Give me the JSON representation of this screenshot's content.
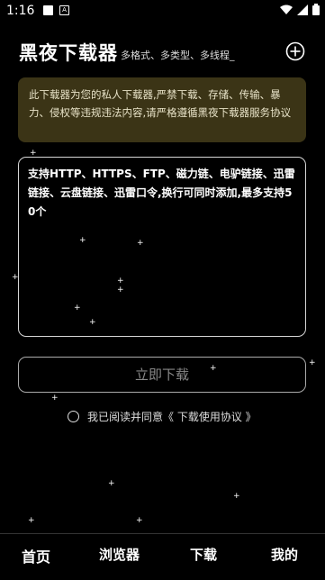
{
  "status_bar": {
    "time": "1:16"
  },
  "header": {
    "title": "黑夜下载器",
    "subtitle": "多格式、多类型、多线程_"
  },
  "notice": {
    "text": "此下载器为您的私人下载器,严禁下载、存储、传输、暴力、侵权等违规违法内容,请严格遵循黑夜下载器服务协议"
  },
  "url_input": {
    "placeholder": "支持HTTP、HTTPS、FTP、磁力链、电驴链接、迅雷链接、云盘链接、迅雷口令,换行可同时添加,最多支持50个"
  },
  "download_button": {
    "label": "立即下载"
  },
  "agreement": {
    "text": "我已阅读并同意《 下载使用协议 》"
  },
  "bottom_nav": {
    "home": "首页",
    "browser": "浏览器",
    "download": "下载",
    "mine": "我的"
  },
  "colors": {
    "background": "#000000",
    "notice_bg": "#3b3416",
    "notice_text": "#e8e3c8"
  }
}
